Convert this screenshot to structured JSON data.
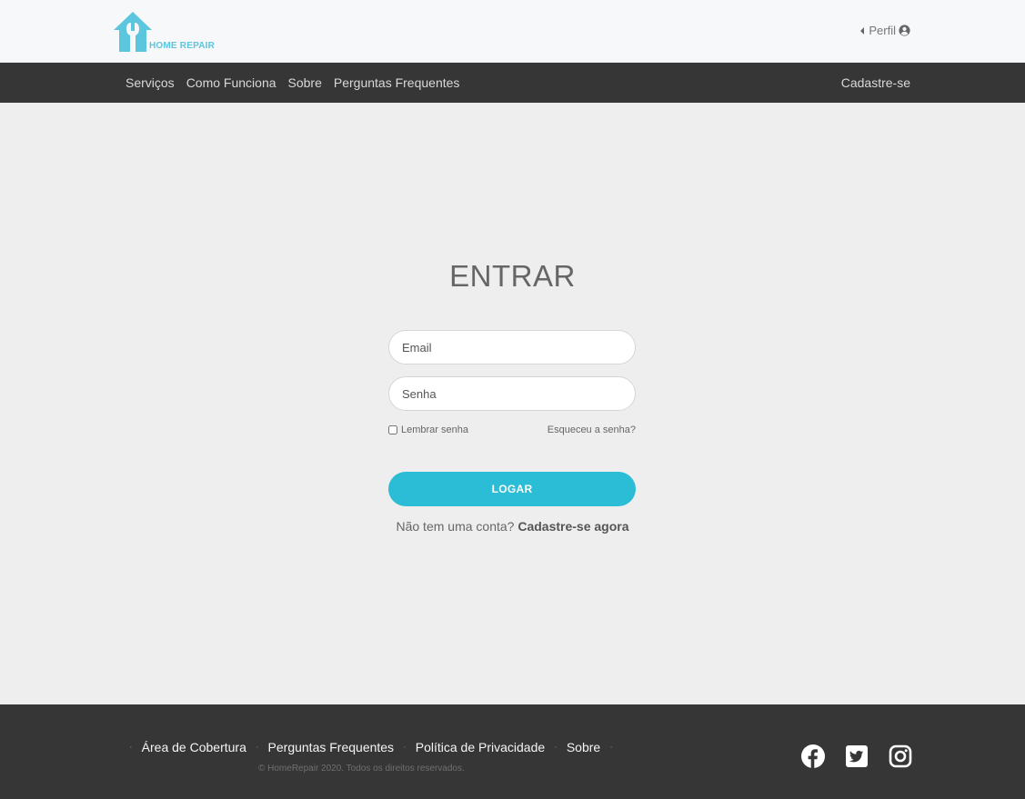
{
  "brand": {
    "name": "HOME REPAIR",
    "color": "#5bc6dd"
  },
  "header": {
    "profile_label": "Perfil"
  },
  "nav": {
    "items": [
      "Serviços",
      "Como Funciona",
      "Sobre",
      "Perguntas Frequentes"
    ],
    "signup": "Cadastre-se"
  },
  "login": {
    "title": "ENTRAR",
    "email_placeholder": "Email",
    "password_placeholder": "Senha",
    "remember_label": "Lembrar senha",
    "forgot_label": "Esqueceu a senha?",
    "submit_label": "LOGAR",
    "no_account_text": "Não tem uma conta?",
    "signup_link": "Cadastre-se agora"
  },
  "footer": {
    "links": [
      "Área de Cobertura",
      "Perguntas Frequentes",
      "Política de Privacidade",
      "Sobre"
    ],
    "copyright": "© HomeRepair 2020. Todos os direitos reservados.",
    "social": [
      "facebook-icon",
      "twitter-icon",
      "instagram-icon"
    ]
  },
  "colors": {
    "accent": "#2bbdd6",
    "nav_bg": "#363636",
    "page_bg": "#eeeeee"
  }
}
